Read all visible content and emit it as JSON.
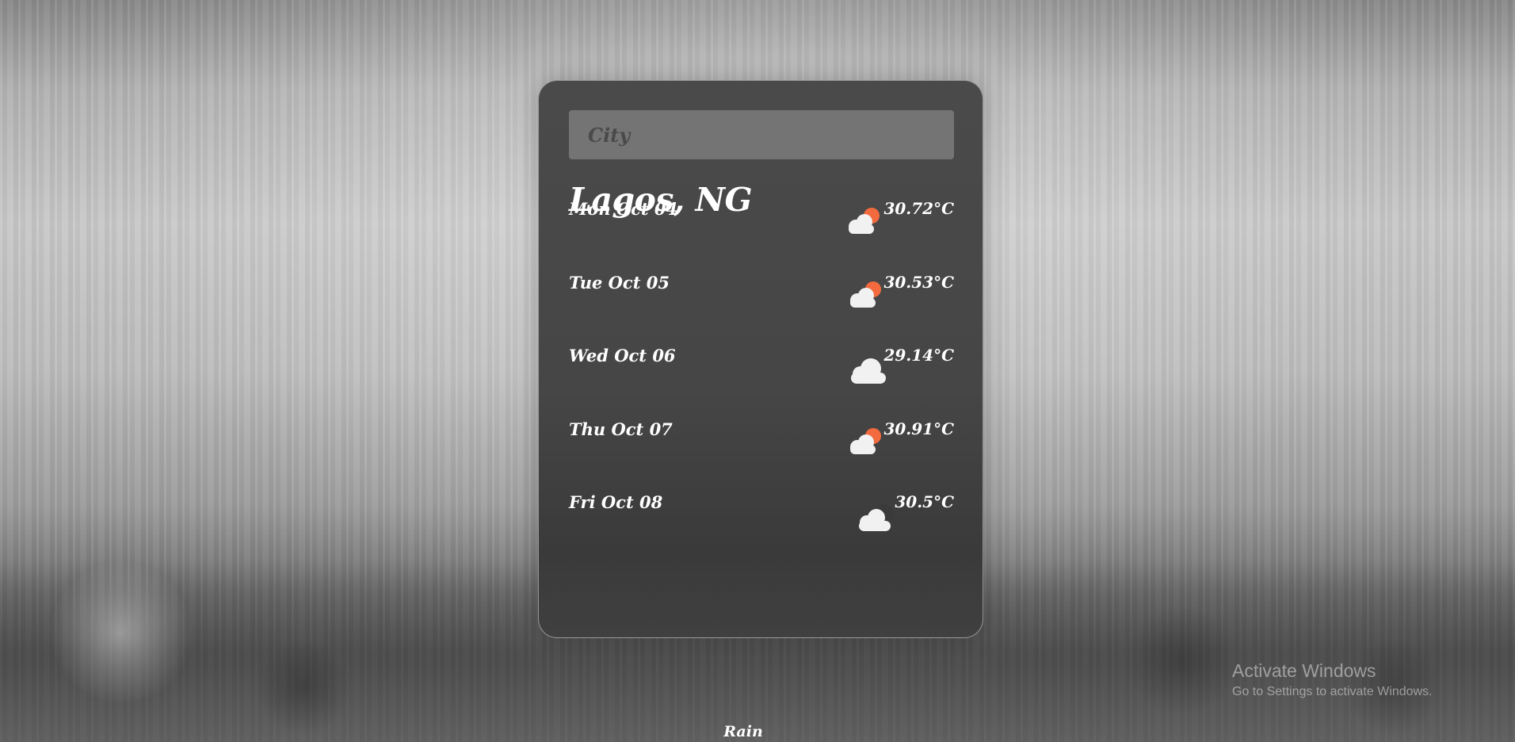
{
  "search": {
    "placeholder": "City"
  },
  "location": {
    "title": "Lagos, NG"
  },
  "forecast": [
    {
      "date": "Mon Oct 04",
      "temp": "30.72°C",
      "icon": "sun-cloud-icon"
    },
    {
      "date": "Tue Oct 05",
      "temp": "30.53°C",
      "icon": "sun-cloud-icon"
    },
    {
      "date": "Wed Oct 06",
      "temp": "29.14°C",
      "icon": "cloud-icon"
    },
    {
      "date": "Thu Oct 07",
      "temp": "30.91°C",
      "icon": "sun-cloud-icon"
    },
    {
      "date": "Fri Oct 08",
      "temp": "30.5°C",
      "icon": "dark-cloud-icon"
    }
  ],
  "condition": "Rain",
  "watermark": {
    "line1": "Activate Windows",
    "line2": "Go to Settings to activate Windows."
  },
  "colors": {
    "sun": "#f26a3d",
    "cloud": "#f1f1f1",
    "dark_cloud": "#3a3a3a"
  }
}
